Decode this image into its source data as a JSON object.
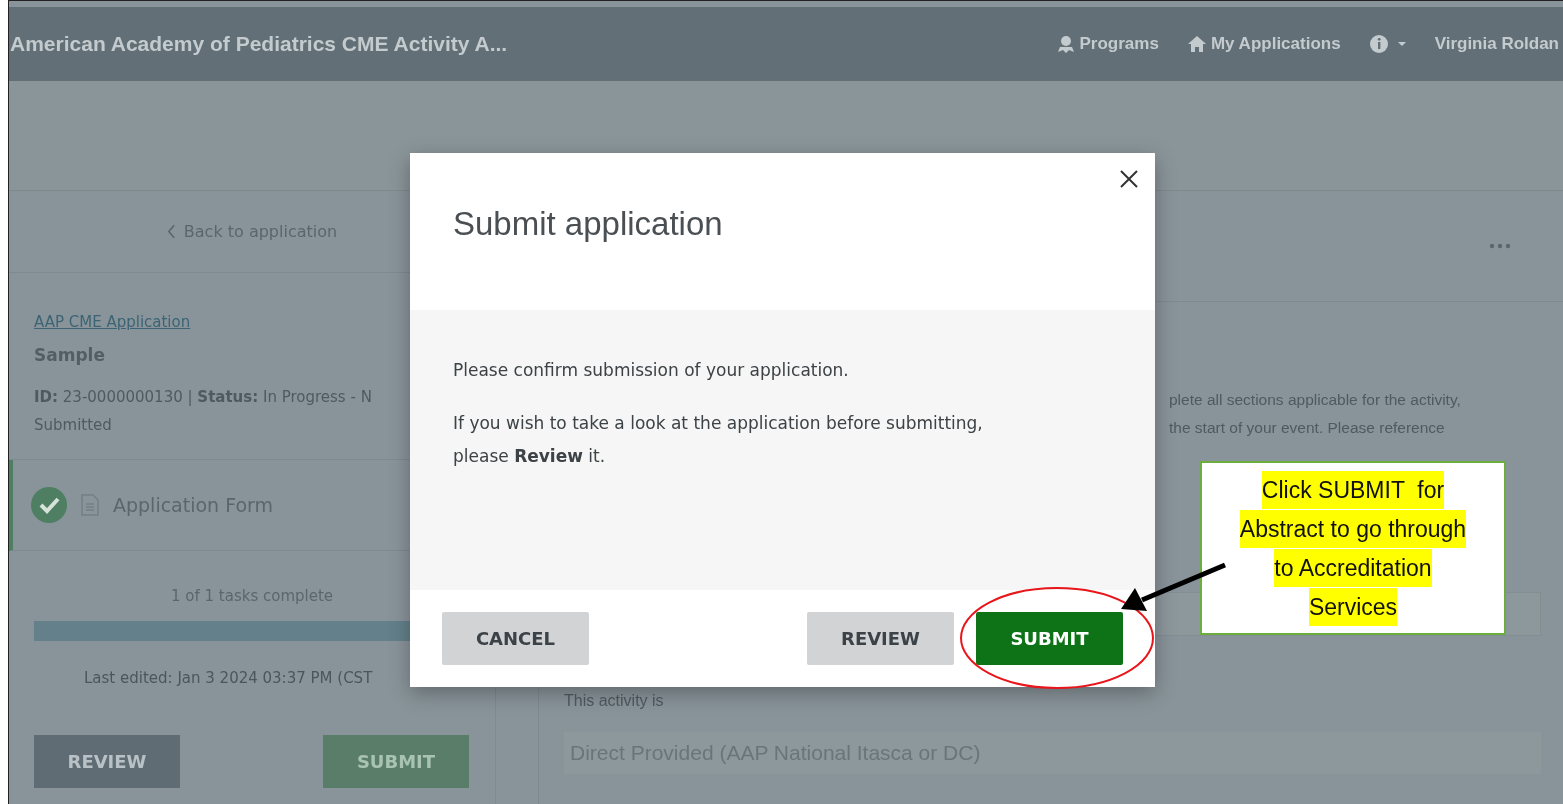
{
  "nav": {
    "title": "American Academy of Pediatrics CME Activity A...",
    "links": [
      {
        "kind": "programs",
        "label": "Programs"
      },
      {
        "kind": "home",
        "label": "My Applications"
      }
    ],
    "user": "Virginia Roldan"
  },
  "sidebar": {
    "back_link": "Back to application",
    "application_link": "AAP CME Application",
    "name": "Sample",
    "meta": [
      "**ID:** 23-0000000130 | **Status:** In Progress - N",
      "Submitted"
    ],
    "task": {
      "label": "Application Form",
      "complete": true
    },
    "progress": {
      "text": "1 of 1 tasks complete",
      "level": 1
    },
    "last_edited": "Last edited: Jan 3 2024 03:37 PM (CST",
    "buttons": [
      {
        "kind": "secondary",
        "label": "REVIEW"
      },
      {
        "kind": "primary",
        "label": "SUBMIT"
      }
    ]
  },
  "main": {
    "instructions": [
      "plete all sections applicable for the activity,",
      "the start of your event. Please reference"
    ],
    "activity_label": "This activity is",
    "activity_value": "Direct Provided (AAP National Itasca or DC)"
  },
  "modal": {
    "title": "Submit application",
    "messages": [
      "Please confirm submission of your application.",
      "If you wish to take a look at the application before submitting, please **Review** it."
    ],
    "buttons": [
      {
        "kind": "secondary",
        "label": "CANCEL"
      },
      {
        "kind": "secondary",
        "label": "REVIEW"
      },
      {
        "kind": "primary",
        "label": "SUBMIT"
      }
    ]
  },
  "callout": {
    "lines": [
      "Click SUBMIT  for",
      "Abstract to go through",
      "to Accreditation",
      "Services"
    ]
  }
}
